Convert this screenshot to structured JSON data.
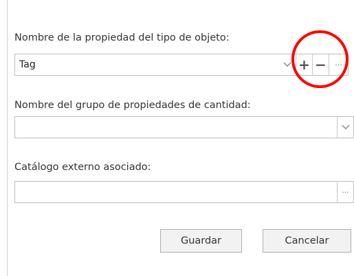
{
  "form": {
    "object_type_property_label": "Nombre de la propiedad del tipo de objeto:",
    "object_type_property_value": "Tag",
    "quantity_group_label": "Nombre del grupo de propiedades de cantidad:",
    "quantity_group_value": "",
    "external_catalog_label": "Catálogo externo asociado:",
    "external_catalog_value": ""
  },
  "buttons": {
    "add": "+",
    "remove": "−",
    "more": "···",
    "save": "Guardar",
    "cancel": "Cancelar"
  },
  "icons": {
    "dropdown": "chevron-down-icon",
    "add": "plus-icon",
    "remove": "minus-icon",
    "more": "ellipsis-icon"
  },
  "colors": {
    "annotation": "#ff0000",
    "border": "#bdbdbd",
    "button_bg": "#f2f2f2"
  }
}
